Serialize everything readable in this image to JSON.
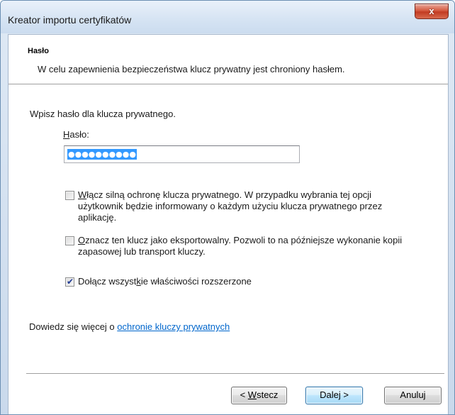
{
  "window": {
    "title": "Kreator importu certyfikatów",
    "close_glyph": "x"
  },
  "header": {
    "title": "Hasło",
    "description": "W celu zapewnienia bezpieczeństwa klucz prywatny jest chroniony hasłem."
  },
  "form": {
    "prompt": "Wpisz hasło dla klucza prywatnego.",
    "password_label_mnemonic": "H",
    "password_label_rest": "asło:",
    "password_value": "●●●●●●●●●●"
  },
  "options": [
    {
      "checked": false,
      "mnemonic_before": "",
      "mnemonic": "W",
      "text_after": "łącz silną ochronę klucza prywatnego. W przypadku wybrania tej opcji użytkownik będzie informowany o każdym użyciu klucza prywatnego przez aplikację."
    },
    {
      "checked": false,
      "mnemonic_before": "",
      "mnemonic": "O",
      "text_after": "znacz ten klucz jako eksportowalny. Pozwoli to na późniejsze wykonanie kopii zapasowej lub transport kluczy."
    },
    {
      "checked": true,
      "mnemonic_before": "Dołącz wszyst",
      "mnemonic": "k",
      "text_after": "ie właściwości rozszerzone"
    }
  ],
  "learn_more": {
    "prefix": "Dowiedz się więcej o ",
    "link_text": "ochronie kluczy prywatnych"
  },
  "buttons": {
    "back_prefix": "< ",
    "back_mnemonic": "W",
    "back_rest": "stecz",
    "next": "Dalej >",
    "cancel": "Anuluj"
  },
  "colors": {
    "link": "#0066cc",
    "selection": "#3399ff",
    "close_button": "#c23b22"
  },
  "icons": {
    "close": "close-icon",
    "checkmark": "checkmark-icon"
  }
}
